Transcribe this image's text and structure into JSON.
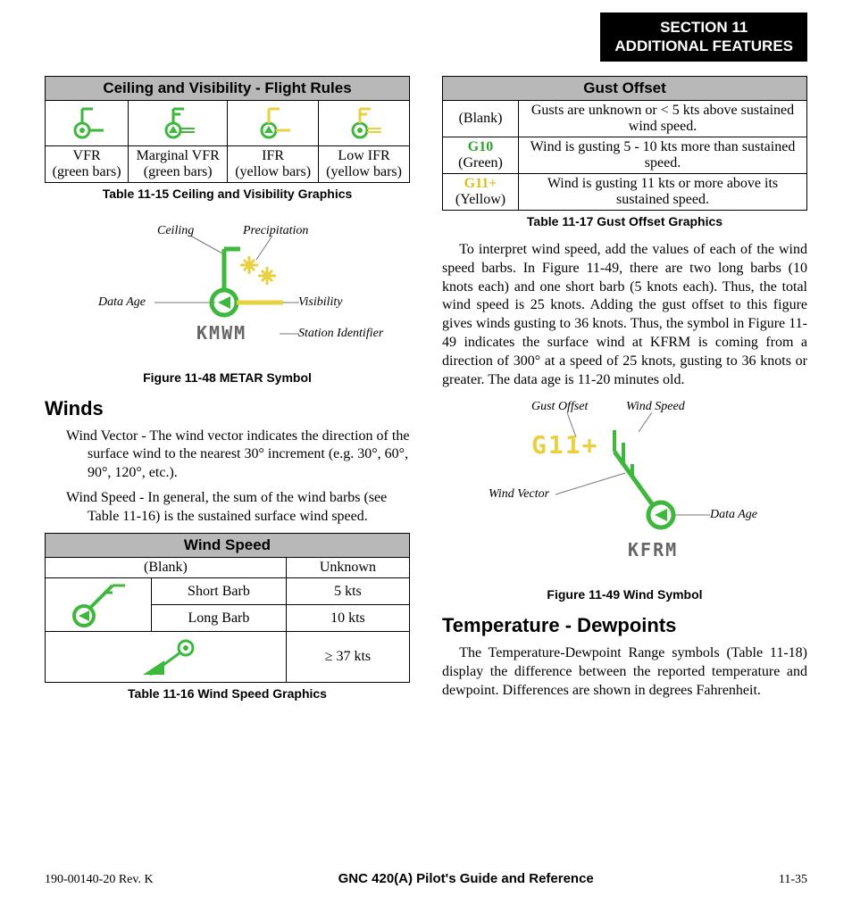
{
  "header": {
    "line1": "SECTION 11",
    "line2": "ADDITIONAL FEATURES"
  },
  "left": {
    "table_cv": {
      "title": "Ceiling and Visibility - Flight Rules",
      "cells": [
        {
          "label": "VFR",
          "sub": "(green bars)"
        },
        {
          "label": "Marginal VFR",
          "sub": "(green bars)"
        },
        {
          "label": "IFR",
          "sub": "(yellow bars)"
        },
        {
          "label": "Low IFR",
          "sub": "(yellow bars)"
        }
      ],
      "caption": "Table 11-15  Ceiling and Visibility Graphics"
    },
    "fig48": {
      "labels": {
        "ceiling": "Ceiling",
        "precip": "Precipitation",
        "dataage": "Data Age",
        "vis": "Visibility",
        "station": "Station Identifier"
      },
      "station": "KMWM",
      "caption": "Figure 11-48  METAR Symbol"
    },
    "winds_heading": "Winds",
    "wind_vector_text": "Wind Vector - The wind vector indicates the direction of the surface wind to the nearest 30° increment (e.g. 30°, 60°, 90°, 120°, etc.).",
    "wind_speed_text": "Wind Speed - In general, the sum of the wind barbs (see Table 11-16) is the sustained surface wind speed.",
    "table_ws": {
      "title": "Wind Speed",
      "rows": [
        {
          "label": "(Blank)",
          "val": "Unknown"
        },
        {
          "label": "Short Barb",
          "val": "5 kts"
        },
        {
          "label": "Long Barb",
          "val": "10 kts"
        },
        {
          "label": "",
          "val": "≥ 37 kts"
        }
      ],
      "caption": "Table 11-16  Wind Speed Graphics"
    }
  },
  "right": {
    "table_gust": {
      "title": "Gust Offset",
      "rows": [
        {
          "code": "(Blank)",
          "sub": "",
          "desc": "Gusts are unknown or < 5 kts above sustained wind speed."
        },
        {
          "code": "G10",
          "sub": "(Green)",
          "desc": "Wind is gusting 5 - 10 kts more than sustained speed."
        },
        {
          "code": "G11+",
          "sub": "(Yellow)",
          "desc": "Wind is gusting 11 kts or more above its sustained speed."
        }
      ],
      "caption": "Table 11-17  Gust Offset Graphics"
    },
    "para1": "To interpret wind speed, add the values of each of the wind speed barbs.  In Figure 11-49, there are two long barbs (10 knots each) and one short barb (5 knots each). Thus, the total wind speed is 25 knots.  Adding the gust offset to this figure gives winds gusting to 36 knots.  Thus, the symbol in Figure 11-49 indicates the surface wind at KFRM is coming from a direction of 300° at a speed of 25 knots, gusting to 36 knots or greater.  The data age is 11-20 minutes old.",
    "fig49": {
      "labels": {
        "gust": "Gust Offset",
        "windspeed": "Wind Speed",
        "windvector": "Wind Vector",
        "dataage": "Data Age"
      },
      "gust_text": "G11+",
      "station": "KFRM",
      "caption": "Figure 11-49  Wind Symbol"
    },
    "temp_heading": "Temperature - Dewpoints",
    "para2": "The Temperature-Dewpoint Range symbols (Table 11-18) display the difference between the reported temperature and dewpoint.  Differences are shown in degrees Fahrenheit."
  },
  "footer": {
    "left": "190-00140-20  Rev. K",
    "center": "GNC 420(A) Pilot's Guide and Reference",
    "right": "11-35"
  }
}
